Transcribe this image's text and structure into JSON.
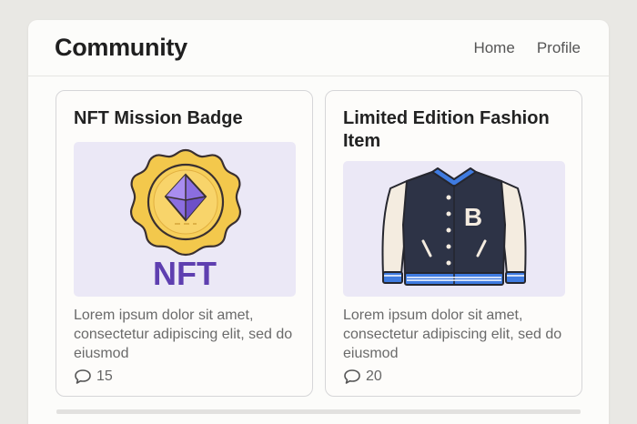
{
  "header": {
    "title": "Community",
    "nav": {
      "home": "Home",
      "profile": "Profile"
    }
  },
  "cards": [
    {
      "title": "NFT Mission Badge",
      "image_text": "NFT",
      "image_icon": "nft-badge-illustration",
      "description": "Lorem ipsum dolor sit amet, consectetur adipiscing elit, sed do eiusmod",
      "comment_count": "15",
      "comment_icon": "comment-icon"
    },
    {
      "title": "Limited Edition Fashion Item",
      "image_text": "B",
      "image_icon": "varsity-jacket-illustration",
      "description": "Lorem ipsum dolor sit amet, consectetur adipiscing elit, sed do eiusmod",
      "comment_count": "20",
      "comment_icon": "comment-icon"
    }
  ],
  "colors": {
    "background": "#e9e8e4",
    "panel": "#fcfcfa",
    "thumb_bg": "#ebe8f6",
    "badge_gold": "#f3c84c",
    "nft_purple": "#5e3fb0",
    "jacket_navy": "#2d3346",
    "jacket_accent": "#3f7be0"
  }
}
